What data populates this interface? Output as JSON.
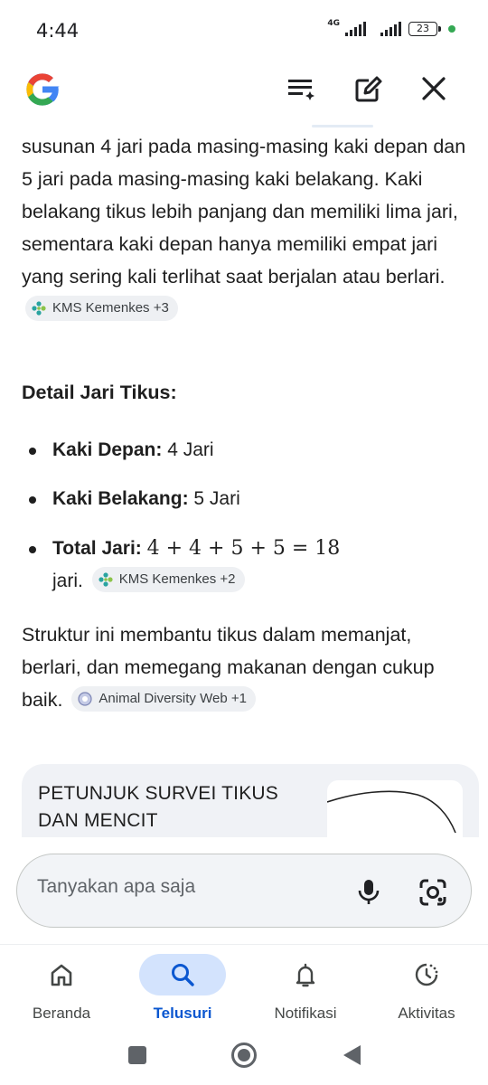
{
  "status_bar": {
    "time": "4:44",
    "network": "4G",
    "battery": "23"
  },
  "top_bar": {
    "icons": [
      "google-logo",
      "playlist-add-icon",
      "edit-note-icon",
      "close-icon"
    ]
  },
  "content": {
    "paragraph1_text": "susunan 4 jari pada masing-masing kaki depan dan 5 jari pada masing-masing kaki belakang. Kaki belakang tikus lebih panjang dan memiliki lima jari, sementara kaki depan hanya memiliki empat jari yang sering kali terlihat saat berjalan atau berlari.",
    "paragraph1_chip": "KMS Kemenkes +3",
    "heading": "Detail Jari Tikus:",
    "bullets": [
      {
        "label": "Kaki Depan:",
        "value": "4 Jari"
      },
      {
        "label": "Kaki Belakang:",
        "value": "5 Jari"
      },
      {
        "label": "Total Jari:",
        "value": "4 + 4 + 5 + 5 = 18",
        "suffix": "jari.",
        "chip": "KMS Kemenkes +2"
      }
    ],
    "paragraph2_text": "Struktur ini membantu tikus dalam memanjat, berlari, dan memegang makanan dengan cukup baik.",
    "paragraph2_chip": "Animal Diversity Web +1",
    "card_title": "PETUNJUK SURVEI TIKUS DAN MENCIT"
  },
  "search": {
    "placeholder": "Tanyakan apa saja"
  },
  "bottom_nav": {
    "items": [
      {
        "label": "Beranda",
        "icon": "home-icon",
        "active": false
      },
      {
        "label": "Telusuri",
        "icon": "search-icon",
        "active": true
      },
      {
        "label": "Notifikasi",
        "icon": "bell-icon",
        "active": false
      },
      {
        "label": "Aktivitas",
        "icon": "activity-icon",
        "active": false
      }
    ]
  },
  "colors": {
    "accent": "#0b57d0",
    "active_pill": "#d3e3fd",
    "chip_bg": "#eef0f3",
    "card_bg": "#f0f2f6"
  }
}
